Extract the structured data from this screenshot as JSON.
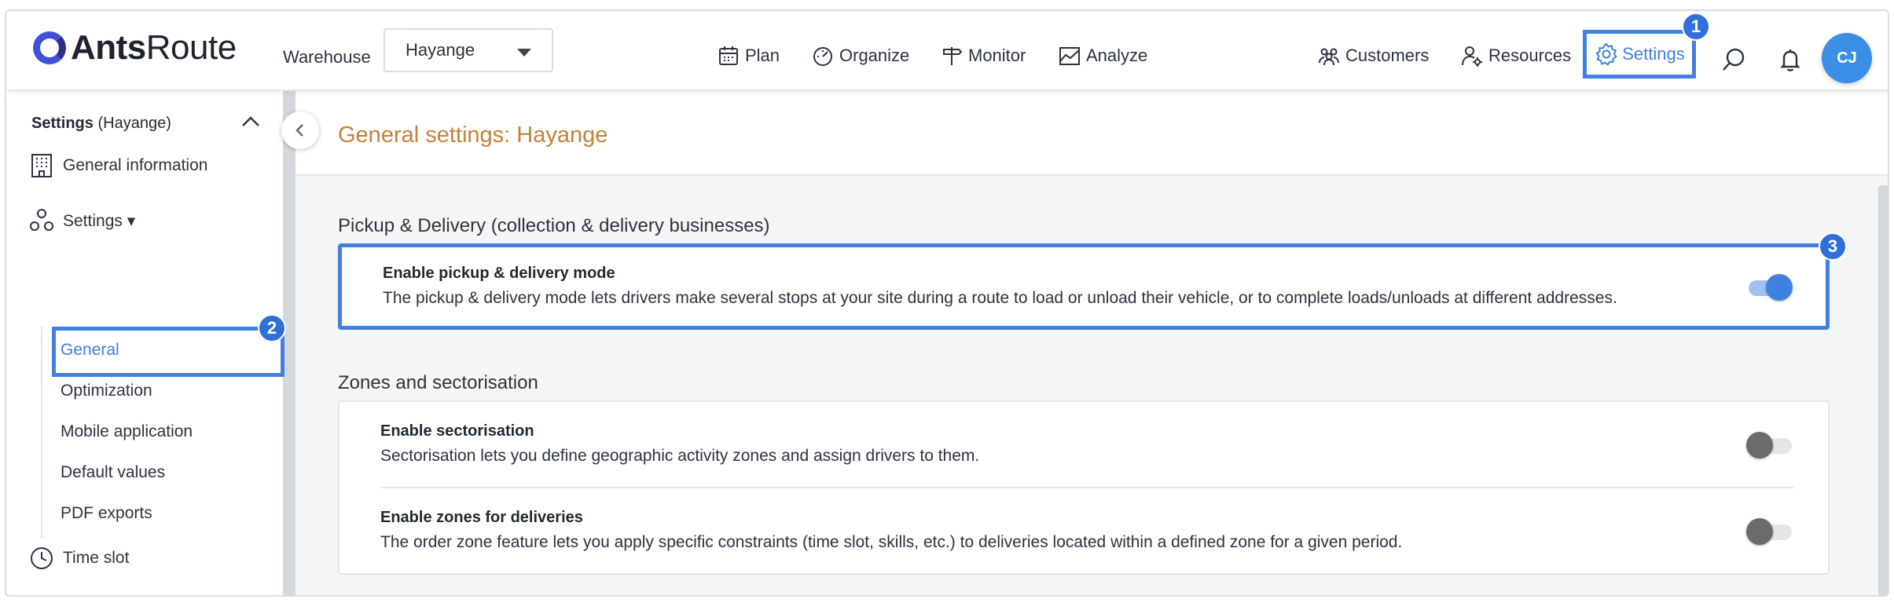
{
  "header": {
    "logo_bold": "Ants",
    "logo_light": "Route",
    "warehouse_label": "Warehouse",
    "warehouse_value": "Hayange",
    "nav": {
      "plan": "Plan",
      "organize": "Organize",
      "monitor": "Monitor",
      "analyze": "Analyze",
      "customers": "Customers",
      "resources": "Resources",
      "settings": "Settings"
    },
    "avatar_initials": "CJ"
  },
  "badges": {
    "settings": "1",
    "general": "2",
    "pickup": "3"
  },
  "sidebar": {
    "title_bold": "Settings",
    "title_rest": "(Hayange)",
    "general_information": "General information",
    "settings_group": "Settings ▾",
    "sub_items": [
      "General",
      "Optimization",
      "Mobile application",
      "Default values",
      "PDF exports"
    ],
    "time_slot": "Time slot"
  },
  "main": {
    "page_title": "General settings: Hayange",
    "pickup_section": "Pickup & Delivery (collection & delivery businesses)",
    "pickup_title": "Enable pickup & delivery mode",
    "pickup_desc": "The pickup & delivery mode lets drivers make several stops at your site during a route to load or unload their vehicle, or to complete loads/unloads at different addresses.",
    "pickup_enabled": true,
    "zones_section": "Zones and sectorisation",
    "sector_title": "Enable sectorisation",
    "sector_desc": "Sectorisation lets you define geographic activity zones and assign drivers to them.",
    "sector_enabled": false,
    "zones_title": "Enable zones for deliveries",
    "zones_desc": "The order zone feature lets you apply specific constraints (time slot, skills, etc.) to deliveries located within a defined zone for a given period.",
    "zones_enabled": false
  },
  "colors": {
    "accent": "#3f80e0",
    "title": "#c5803a",
    "badge": "#2f6fd8"
  }
}
